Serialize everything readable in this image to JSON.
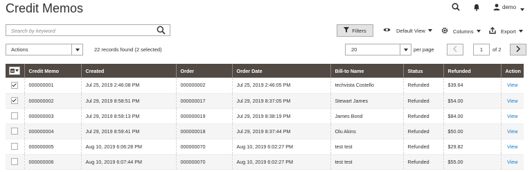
{
  "page": {
    "title": "Credit Memos"
  },
  "header": {
    "user_name": "demo"
  },
  "search": {
    "placeholder": "Search by keyword",
    "value": ""
  },
  "toolbar": {
    "filters_label": "Filters",
    "view_label": "Default View",
    "columns_label": "Columns",
    "export_label": "Export"
  },
  "actions": {
    "label": "Actions"
  },
  "records": {
    "summary": "22 records found (2 selected)"
  },
  "pagination": {
    "per_page": "20",
    "per_page_label": "per page",
    "current_page": "1",
    "of_label": "of 2"
  },
  "table": {
    "columns": [
      "Credit Memo",
      "Created",
      "Order",
      "Order Date",
      "Bill-to Name",
      "Status",
      "Refunded",
      "Action"
    ],
    "rows": [
      {
        "checked": true,
        "memo": "000000001",
        "created": "Jul 25, 2019 2:46:08 PM",
        "order": "000000002",
        "order_date": "Jul 25, 2019 2:46:05 PM",
        "bill_to": "techvista Costello",
        "status": "Refunded",
        "refunded": "$39.64",
        "action": "View"
      },
      {
        "checked": true,
        "memo": "000000002",
        "created": "Jul 29, 2019 8:58:51 PM",
        "order": "000000017",
        "order_date": "Jul 29, 2019 8:37:05 PM",
        "bill_to": "Stewart James",
        "status": "Refunded",
        "refunded": "$54.00",
        "action": "View"
      },
      {
        "checked": false,
        "memo": "000000003",
        "created": "Jul 29, 2019 8:59:13 PM",
        "order": "000000019",
        "order_date": "Jul 29, 2019 8:38:19 PM",
        "bill_to": "James Bond",
        "status": "Refunded",
        "refunded": "$84.00",
        "action": "View"
      },
      {
        "checked": false,
        "memo": "000000004",
        "created": "Jul 29, 2019 8:59:41 PM",
        "order": "000000018",
        "order_date": "Jul 29, 2019 8:37:44 PM",
        "bill_to": "Olu Akins",
        "status": "Refunded",
        "refunded": "$50.00",
        "action": "View"
      },
      {
        "checked": false,
        "memo": "000000005",
        "created": "Aug 10, 2019 6:06:28 PM",
        "order": "000000070",
        "order_date": "Aug 10, 2019 6:02:27 PM",
        "bill_to": "test test",
        "status": "Refunded",
        "refunded": "$29.82",
        "action": "View"
      },
      {
        "checked": false,
        "memo": "000000006",
        "created": "Aug 10, 2019 6:07:44 PM",
        "order": "000000070",
        "order_date": "Aug 10, 2019 6:02:27 PM",
        "bill_to": "test test",
        "status": "Refunded",
        "refunded": "$55.00",
        "action": "View"
      }
    ]
  },
  "colors": {
    "header_bg": "#514943",
    "link": "#1979c3",
    "accent_button": "#e3e3e3"
  }
}
